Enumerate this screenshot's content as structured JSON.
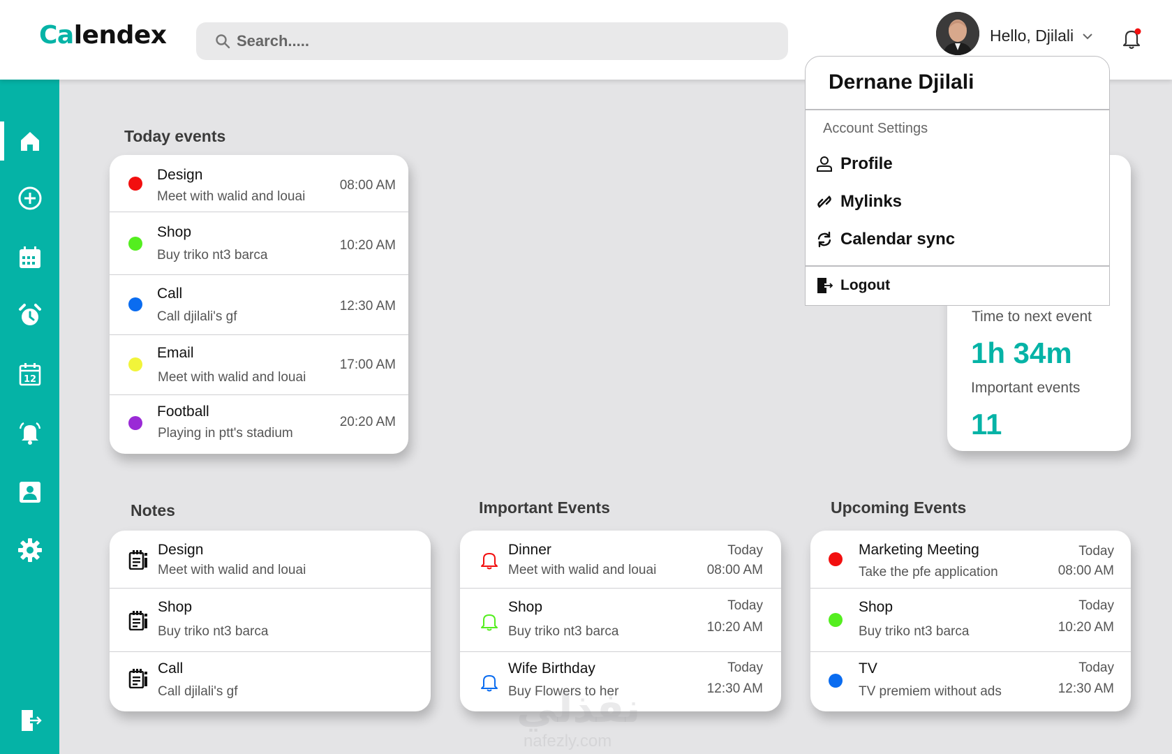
{
  "header": {
    "logo_a": "Ca",
    "logo_b": "lendex",
    "search_placeholder": "Search.....",
    "greeting": "Hello, Djilali"
  },
  "colors": {
    "accent": "#05b3a6",
    "red": "#f20f0f",
    "green": "#54ee1f",
    "blue": "#0a6cf0",
    "yellow": "#f1f43a",
    "purple": "#9a2ad6"
  },
  "sidebar": {
    "items": [
      {
        "icon": "home-icon"
      },
      {
        "icon": "plus-circle-icon"
      },
      {
        "icon": "calendar-grid-icon"
      },
      {
        "icon": "alarm-clock-icon"
      },
      {
        "icon": "calendar-day-icon"
      },
      {
        "icon": "bell-icon"
      },
      {
        "icon": "contact-icon"
      },
      {
        "icon": "gear-icon"
      }
    ],
    "bottom_icon": "logout-icon"
  },
  "today": {
    "title": "Today events",
    "events": [
      {
        "title": "Design",
        "subtitle": "Meet with walid and louai",
        "time": "08:00 AM",
        "color": "#f20f0f"
      },
      {
        "title": "Shop",
        "subtitle": "Buy triko nt3 barca",
        "time": "10:20 AM",
        "color": "#54ee1f"
      },
      {
        "title": "Call",
        "subtitle": "Call djilali's gf",
        "time": "12:30 AM",
        "color": "#0a6cf0"
      },
      {
        "title": "Email",
        "subtitle": "Meet with walid and louai",
        "time": "17:00 AM",
        "color": "#f1f43a"
      },
      {
        "title": "Football",
        "subtitle": "Playing in ptt's stadium",
        "time": "20:20 AM",
        "color": "#9a2ad6"
      }
    ]
  },
  "stats": {
    "next_label": "Time to next event",
    "next_value": "1h 34m",
    "important_label": "Important events",
    "important_value": "11"
  },
  "account": {
    "name": "Dernane Djilali",
    "section": "Account Settings",
    "items": [
      {
        "label": "Profile",
        "icon": "user-icon"
      },
      {
        "label": "Mylinks",
        "icon": "link-icon"
      },
      {
        "label": "Calendar sync",
        "icon": "sync-icon"
      }
    ],
    "logout": "Logout"
  },
  "notes": {
    "title": "Notes",
    "items": [
      {
        "title": "Design",
        "subtitle": "Meet with walid and louai"
      },
      {
        "title": "Shop",
        "subtitle": "Buy triko nt3 barca"
      },
      {
        "title": "Call",
        "subtitle": "Call djilali's gf"
      }
    ]
  },
  "important": {
    "title": "Important Events",
    "items": [
      {
        "title": "Dinner",
        "subtitle": "Meet with walid and louai",
        "day": "Today",
        "time": "08:00 AM",
        "color": "#f20f0f"
      },
      {
        "title": "Shop",
        "subtitle": "Buy triko nt3 barca",
        "day": "Today",
        "time": "10:20 AM",
        "color": "#54ee1f"
      },
      {
        "title": "Wife Birthday",
        "subtitle": "Buy Flowers to her",
        "day": "Today",
        "time": "12:30 AM",
        "color": "#0a6cf0"
      }
    ]
  },
  "upcoming": {
    "title": "Upcoming Events",
    "items": [
      {
        "title": "Marketing Meeting",
        "subtitle": "Take the pfe application",
        "day": "Today",
        "time": "08:00 AM",
        "color": "#f20f0f"
      },
      {
        "title": "Shop",
        "subtitle": "Buy triko nt3 barca",
        "day": "Today",
        "time": "10:20 AM",
        "color": "#54ee1f"
      },
      {
        "title": "TV",
        "subtitle": "TV premiem without ads",
        "day": "Today",
        "time": "12:30 AM",
        "color": "#0a6cf0"
      }
    ]
  },
  "watermark": {
    "text": "نفذلي",
    "sub": "nafezly.com"
  }
}
